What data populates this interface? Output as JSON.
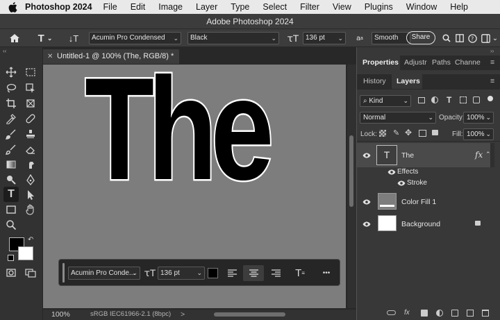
{
  "menubar": {
    "app_name": "Photoshop 2024",
    "items": [
      "File",
      "Edit",
      "Image",
      "Layer",
      "Type",
      "Select",
      "Filter",
      "View",
      "Plugins",
      "Window",
      "Help"
    ]
  },
  "window": {
    "title": "Adobe Photoshop 2024"
  },
  "options": {
    "font_family": "Acumin Pro Condensed",
    "font_style": "Black",
    "font_size": "136 pt",
    "aa_icon": "a",
    "antialias": "Smooth",
    "share_label": "Share"
  },
  "document": {
    "tab_title": "Untitled-1 @ 100% (The, RGB/8) *",
    "canvas_text": "The",
    "zoom": "100%",
    "color_profile": "sRGB IEC61966-2.1 (8bpc)",
    "status_chevron": ">"
  },
  "taskbar": {
    "font_family": "Acumin Pro Conde...",
    "font_size": "136 pt",
    "color_swatch": "#000000",
    "more": "•••"
  },
  "panels": {
    "top_tabs": [
      "Properties",
      "Adjustr",
      "Paths",
      "Channe"
    ],
    "second_tabs": [
      "History",
      "Layers"
    ],
    "kind_filter": "Kind",
    "blend_mode": "Normal",
    "opacity_label": "Opacity:",
    "opacity_value": "100%",
    "lock_label": "Lock:",
    "fill_label": "Fill:",
    "fill_value": "100%",
    "layers": [
      {
        "name": "The",
        "fx": "fx"
      },
      {
        "name": "Effects"
      },
      {
        "name": "Stroke"
      },
      {
        "name": "Color Fill 1"
      },
      {
        "name": "Background"
      }
    ]
  },
  "colors": {
    "foreground": "#000000",
    "background": "#ffffff",
    "canvas": "#7d7d7d",
    "text_stroke": "#ffffff"
  }
}
